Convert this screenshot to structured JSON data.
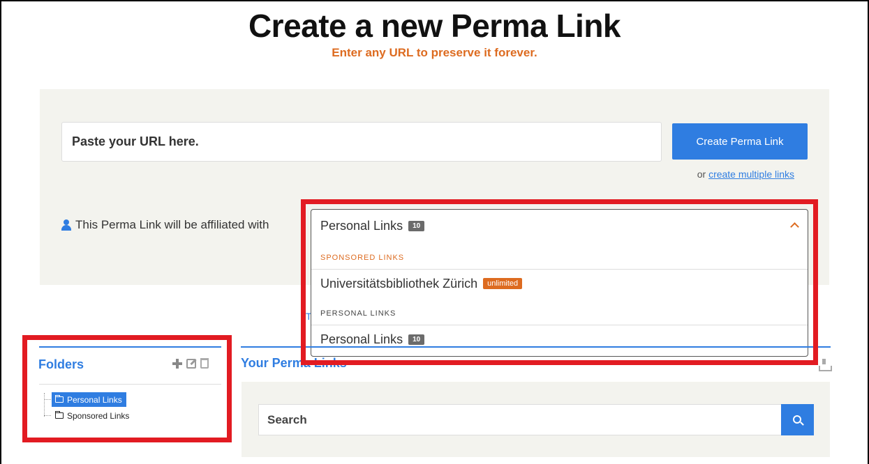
{
  "header": {
    "title": "Create a new Perma Link",
    "subtitle": "Enter any URL to preserve it forever."
  },
  "create_form": {
    "url_placeholder": "Paste your URL here.",
    "create_button_label": "Create Perma Link",
    "multi_prefix": "or",
    "multi_link_label": "create multiple links",
    "affiliation_label": "This Perma Link will be affiliated with"
  },
  "affiliation_dropdown": {
    "selected_label": "Personal Links",
    "selected_badge": "10",
    "groups": [
      {
        "header": "SPONSORED LINKS",
        "option_label": "Universitätsbibliothek Zürich",
        "option_badge": "unlimited"
      },
      {
        "header": "PERSONAL LINKS",
        "option_label": "Personal Links",
        "option_badge": "10"
      }
    ],
    "peek_char": "T"
  },
  "folders": {
    "title": "Folders",
    "items": [
      {
        "label": "Personal Links",
        "selected": true
      },
      {
        "label": "Sponsored Links",
        "selected": false
      }
    ]
  },
  "links": {
    "title": "Your Perma Links",
    "search_placeholder": "Search"
  },
  "colors": {
    "accent_blue": "#2f7de1",
    "accent_orange": "#dd6b20",
    "highlight_red": "#e21b22",
    "panel_bg": "#f3f3ee"
  },
  "icons": [
    "person-icon",
    "chevron-up-icon",
    "plus-icon",
    "edit-icon",
    "trash-icon",
    "folder-icon",
    "download-icon",
    "search-icon"
  ]
}
